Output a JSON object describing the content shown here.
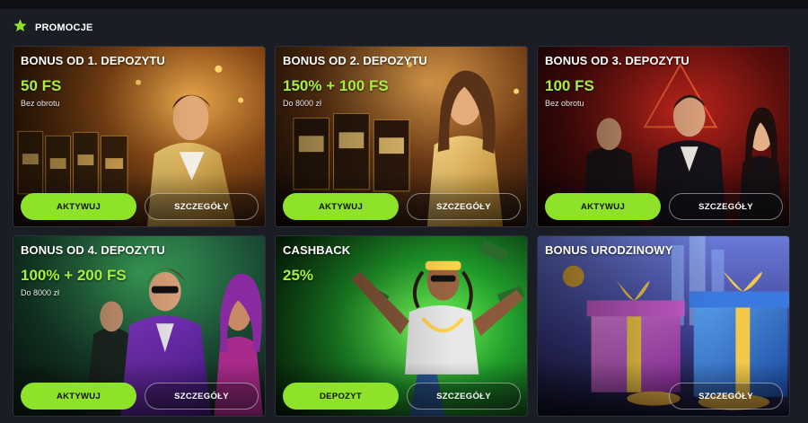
{
  "header": {
    "title": "PROMOCJE",
    "icon": "star-icon",
    "accent": "#8ee22a"
  },
  "cards": [
    {
      "title": "BONUS OD 1. DEPOZYTU",
      "amount": "50 FS",
      "subtitle": "Bez obrotu",
      "primary_label": "AKTYWUJ",
      "secondary_label": "SZCZEGÓŁY",
      "theme": "gold-casino-man"
    },
    {
      "title": "BONUS OD 2. DEPOZYTU",
      "amount": "150% + 100 FS",
      "subtitle": "Do 8000 zł",
      "primary_label": "AKTYWUJ",
      "secondary_label": "SZCZEGÓŁY",
      "theme": "gold-dress-woman"
    },
    {
      "title": "BONUS OD 3. DEPOZYTU",
      "amount": "100 FS",
      "subtitle": "Bez obrotu",
      "primary_label": "AKTYWUJ",
      "secondary_label": "SZCZEGÓŁY",
      "theme": "red-suits-group"
    },
    {
      "title": "BONUS OD 4. DEPOZYTU",
      "amount": "100% + 200 FS",
      "subtitle": "Do 8000 zł",
      "primary_label": "AKTYWUJ",
      "secondary_label": "SZCZEGÓŁY",
      "theme": "purple-suit-group"
    },
    {
      "title": "CASHBACK",
      "amount": "25%",
      "subtitle": "",
      "primary_label": "DEPOZYT",
      "secondary_label": "SZCZEGÓŁY",
      "theme": "green-money-character"
    },
    {
      "title": "BONUS URODZINOWY",
      "amount": "",
      "subtitle": "",
      "primary_label": "",
      "secondary_label": "SZCZEGÓŁY",
      "theme": "gift-boxes"
    }
  ]
}
